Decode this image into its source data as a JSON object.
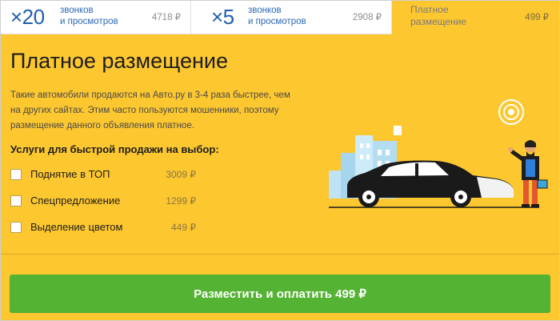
{
  "tabs": [
    {
      "multiplier": "×20",
      "desc_line1": "звонков",
      "desc_line2": "и просмотров",
      "price": "4718 ₽"
    },
    {
      "multiplier": "×5",
      "desc_line1": "звонков",
      "desc_line2": "и просмотров",
      "price": "2908 ₽"
    },
    {
      "desc_line1": "Платное",
      "desc_line2": "размещение",
      "price": "499 ₽"
    }
  ],
  "main": {
    "title": "Платное размещение",
    "info_line1": "Такие автомобили продаются на Авто.ру в 3-4 раза быстрее, чем",
    "info_line2": "на других сайтах. Этим часто пользуются мошенники, поэтому",
    "info_line3": "размещение данного объявления платное.",
    "services_label": "Услуги для быстрой продажи на выбор:",
    "services": [
      {
        "label": "Поднятие в ТОП",
        "price": "3009 ₽"
      },
      {
        "label": "Спецпредложение",
        "price": "1299 ₽"
      },
      {
        "label": "Выделение цветом",
        "price": "449 ₽"
      }
    ]
  },
  "pay_button": {
    "label": "Разместить и оплатить 499 ₽"
  },
  "colors": {
    "background": "#fdc72f",
    "accent_blue": "#1f5fae",
    "button_green": "#54b332"
  },
  "illustration": {
    "icons": [
      "buildings-icon",
      "car-icon",
      "man-icon",
      "target-icon"
    ]
  }
}
